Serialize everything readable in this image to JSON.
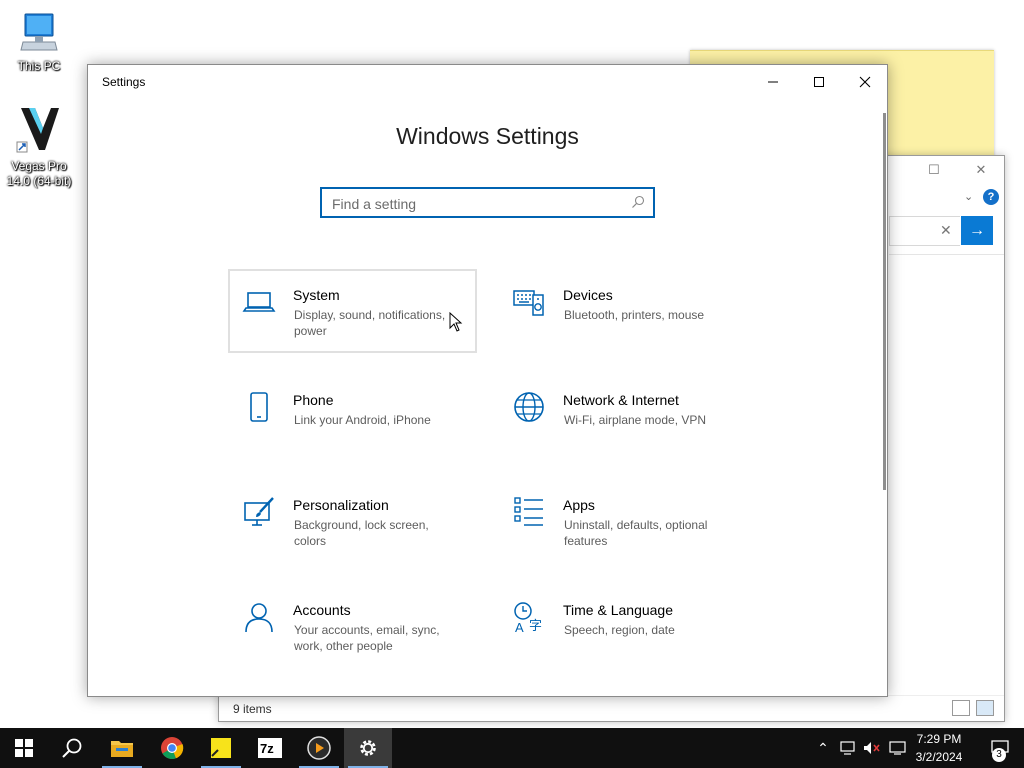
{
  "desktop": {
    "icons": [
      {
        "label": "This PC",
        "icon": "computer-icon"
      },
      {
        "label": "Vegas Pro 14.0 (64-bit)",
        "icon": "vegas-pro-icon"
      }
    ]
  },
  "explorer": {
    "status_text": "9 items"
  },
  "settings": {
    "window_title": "Settings",
    "heading": "Windows Settings",
    "search_placeholder": "Find a setting",
    "tiles": [
      {
        "name": "System",
        "desc": "Display, sound, notifications, power",
        "icon": "laptop-icon"
      },
      {
        "name": "Devices",
        "desc": "Bluetooth, printers, mouse",
        "icon": "keyboard-speaker-icon"
      },
      {
        "name": "Phone",
        "desc": "Link your Android, iPhone",
        "icon": "phone-icon"
      },
      {
        "name": "Network & Internet",
        "desc": "Wi-Fi, airplane mode, VPN",
        "icon": "globe-icon"
      },
      {
        "name": "Personalization",
        "desc": "Background, lock screen, colors",
        "icon": "paintbrush-icon"
      },
      {
        "name": "Apps",
        "desc": "Uninstall, defaults, optional features",
        "icon": "apps-list-icon"
      },
      {
        "name": "Accounts",
        "desc": "Your accounts, email, sync, work, other people",
        "icon": "person-icon"
      },
      {
        "name": "Time & Language",
        "desc": "Speech, region, date",
        "icon": "time-language-icon"
      }
    ]
  },
  "taskbar": {
    "apps": [
      "Start",
      "Search",
      "File Explorer",
      "Google Chrome",
      "Sticky Notes",
      "7-Zip",
      "Media Player",
      "Settings"
    ],
    "clock_time": "7:29 PM",
    "clock_date": "3/2/2024",
    "notification_count": "3"
  },
  "colors": {
    "accent": "#0063b1",
    "taskbar": "#101010",
    "sticky": "#fcf1a6"
  }
}
